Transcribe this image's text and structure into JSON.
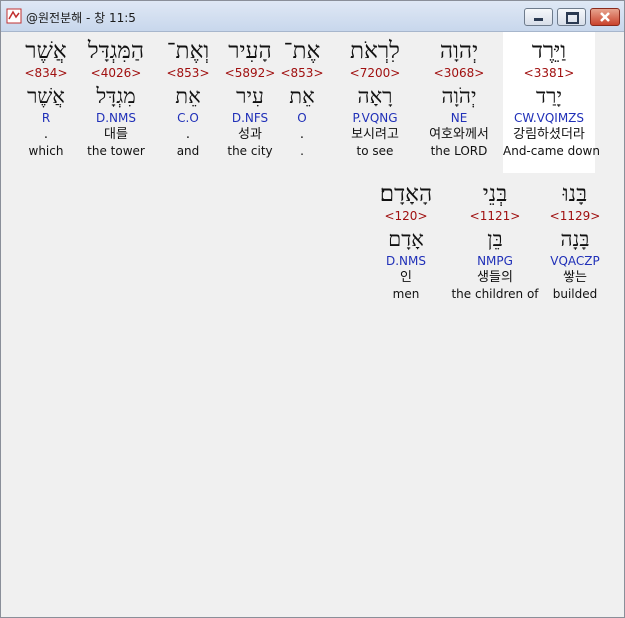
{
  "window": {
    "title": "@원전분해 - 창 11:5"
  },
  "row1": [
    {
      "hebrew": "וַיֵּרֶד",
      "strong": "<3381>",
      "lemma": "יָרַד",
      "morph": "CW.VQIMZS",
      "korean": "강림하셨더라",
      "english": "And-came down",
      "selected": true
    },
    {
      "hebrew": "יְהוָה",
      "strong": "<3068>",
      "lemma": "יְהֹוָה",
      "morph": "NE",
      "korean": "여호와께서",
      "english": "the LORD"
    },
    {
      "hebrew": "לִרְאֹת",
      "strong": "<7200>",
      "lemma": "רָאָה",
      "morph": "P.VQNG",
      "korean": "보시려고",
      "english": "to see"
    },
    {
      "hebrew": "אֶת־",
      "strong": "<853>",
      "lemma": "אֵת",
      "morph": "O",
      "korean": ".",
      "english": "."
    },
    {
      "hebrew": "הָעִיר",
      "strong": "<5892>",
      "lemma": "עִיר",
      "morph": "D.NFS",
      "korean": "성과",
      "english": "the city"
    },
    {
      "hebrew": "וְאֶת־",
      "strong": "<853>",
      "lemma": "אֵת",
      "morph": "C.O",
      "korean": ".",
      "english": "and"
    },
    {
      "hebrew": "הַמִּגְדָּל",
      "strong": "<4026>",
      "lemma": "מִגְדָּל",
      "morph": "D.NMS",
      "korean": "대를",
      "english": "the tower"
    },
    {
      "hebrew": "אֲשֶׁר",
      "strong": "<834>",
      "lemma": "אֲשֶׁר",
      "morph": "R",
      "korean": ".",
      "english": "which"
    }
  ],
  "row2": [
    {
      "hebrew": "בָּנוּ",
      "strong": "<1129>",
      "lemma": "בָּנָה",
      "morph": "VQACZP",
      "korean": "쌓는",
      "english": "builded"
    },
    {
      "hebrew": "בְּנֵי",
      "strong": "<1121>",
      "lemma": "בֵּן",
      "morph": "NMPG",
      "korean": "생들의",
      "english": "the children of"
    },
    {
      "hebrew": "הָאָדָם׃",
      "strong": "<120>",
      "lemma": "אָדָם",
      "morph": "D.NMS",
      "korean": "인",
      "english": "men"
    }
  ]
}
